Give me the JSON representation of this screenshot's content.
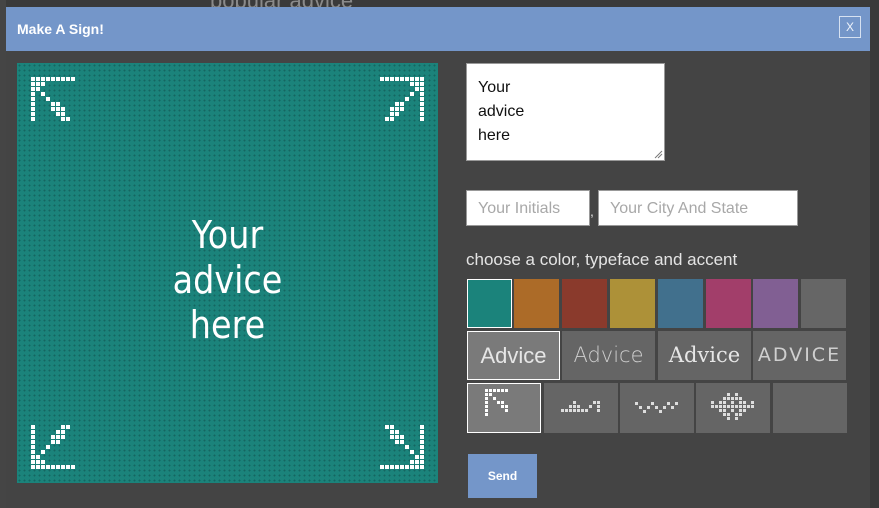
{
  "background": {
    "heading": "popular advice"
  },
  "modal": {
    "title": "Make A Sign!",
    "close_label": "X"
  },
  "sign": {
    "lines": [
      "Your",
      "advice",
      "here"
    ],
    "color": "#1b837b"
  },
  "form": {
    "advice_lines": [
      "Your",
      "advice",
      "here"
    ],
    "initials_placeholder": "Your Initials",
    "separator": ",",
    "location_placeholder": "Your City And State",
    "choose_label": "choose a color, typeface and accent",
    "send_label": "Send"
  },
  "colors": [
    {
      "name": "teal",
      "hex": "#1b837b",
      "selected": true
    },
    {
      "name": "orange",
      "hex": "#ac6b28"
    },
    {
      "name": "red",
      "hex": "#8a3a2c"
    },
    {
      "name": "mustard",
      "hex": "#ad9138"
    },
    {
      "name": "steel-blue",
      "hex": "#41708d"
    },
    {
      "name": "magenta",
      "hex": "#a23e6a"
    },
    {
      "name": "purple",
      "hex": "#815f93"
    },
    {
      "name": "gray",
      "hex": "#666666"
    }
  ],
  "typefaces": [
    {
      "label": "Advice",
      "selected": true
    },
    {
      "label": "Advice"
    },
    {
      "label": "Advice"
    },
    {
      "label": "ADVICE"
    }
  ],
  "accents": [
    {
      "name": "corner-arrows-icon",
      "selected": true
    },
    {
      "name": "mountain-pattern-icon"
    },
    {
      "name": "waves-pattern-icon"
    },
    {
      "name": "invader-pattern-icon"
    },
    {
      "name": "none"
    }
  ]
}
